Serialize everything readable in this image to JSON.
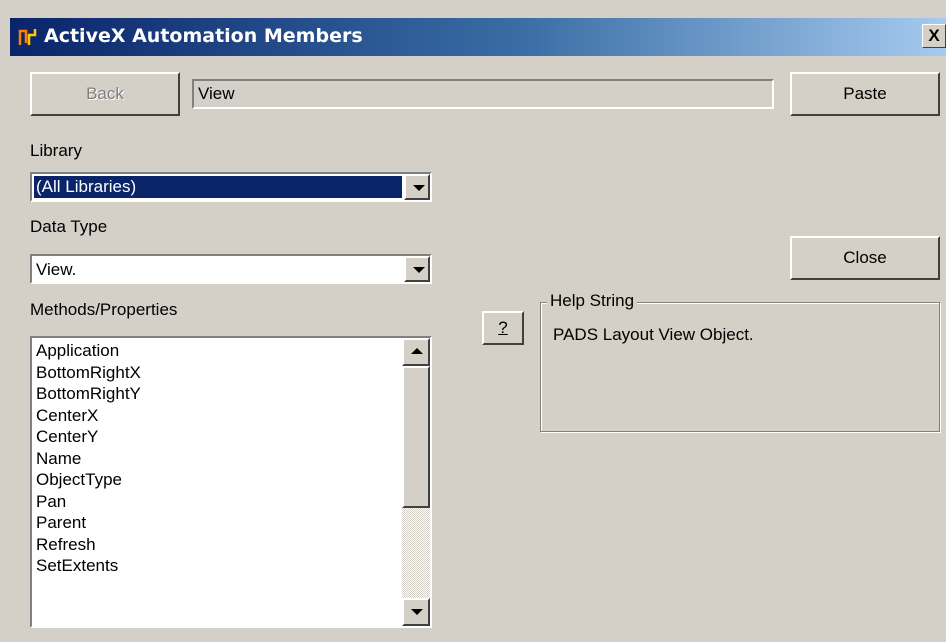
{
  "window": {
    "title": "ActiveX Automation Members",
    "close_glyph": "X",
    "title_icon": "activex-icon"
  },
  "toolbar": {
    "back_label": "Back",
    "path_value": "View",
    "paste_label": "Paste",
    "close_label": "Close"
  },
  "library": {
    "label": "Library",
    "selected": "(All Libraries)"
  },
  "data_type": {
    "label": "Data Type",
    "selected": "View."
  },
  "members": {
    "label": "Methods/Properties",
    "items": [
      "Application",
      "BottomRightX",
      "BottomRightY",
      "CenterX",
      "CenterY",
      "Name",
      "ObjectType",
      "Pan",
      "Parent",
      "Refresh",
      "SetExtents"
    ]
  },
  "help": {
    "button_label": "?",
    "group_label": "Help String",
    "text": "PADS Layout View Object."
  },
  "colors": {
    "face": "#d4d0c8",
    "title_start": "#0a246a",
    "selection": "#0a246a"
  }
}
